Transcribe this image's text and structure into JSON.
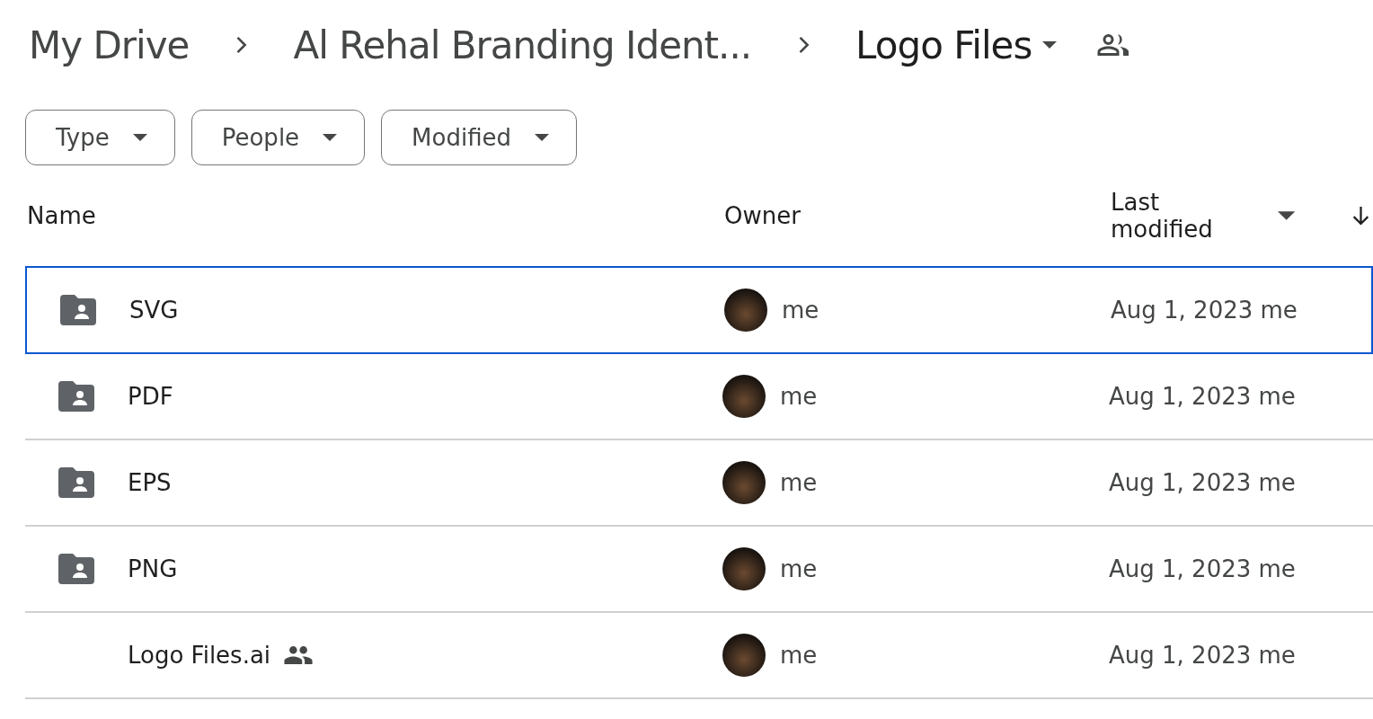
{
  "breadcrumb": [
    {
      "label": "My Drive",
      "kind": "link"
    },
    {
      "label": "Al Rehal Branding Ident...",
      "kind": "link"
    },
    {
      "label": "Logo Files",
      "kind": "current",
      "shared": true
    }
  ],
  "filters": [
    {
      "label": "Type"
    },
    {
      "label": "People"
    },
    {
      "label": "Modified"
    }
  ],
  "table": {
    "columns": [
      {
        "label": "Name"
      },
      {
        "label": "Owner"
      },
      {
        "label": "Last modified",
        "sortable": true
      }
    ],
    "rows": [
      {
        "name": "SVG",
        "kind": "folder",
        "shared": false,
        "selected": true,
        "owner": "me",
        "modified": "Aug 1, 2023 me"
      },
      {
        "name": "PDF",
        "kind": "folder",
        "shared": false,
        "selected": false,
        "owner": "me",
        "modified": "Aug 1, 2023 me"
      },
      {
        "name": "EPS",
        "kind": "folder",
        "shared": false,
        "selected": false,
        "owner": "me",
        "modified": "Aug 1, 2023 me"
      },
      {
        "name": "PNG",
        "kind": "folder",
        "shared": false,
        "selected": false,
        "owner": "me",
        "modified": "Aug 1, 2023 me"
      },
      {
        "name": "Logo Files.ai",
        "kind": "file",
        "shared": true,
        "selected": false,
        "owner": "me",
        "modified": "Aug 1, 2023 me"
      }
    ]
  }
}
